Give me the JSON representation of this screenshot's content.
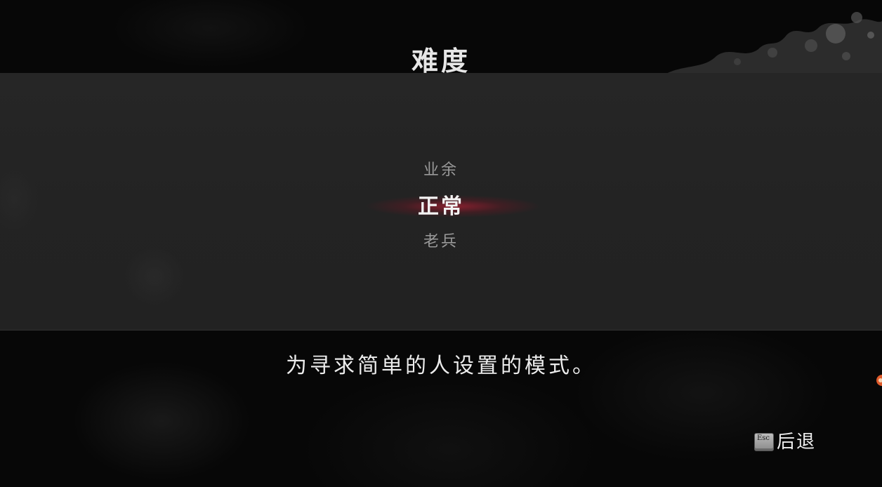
{
  "screen": {
    "title": "难度",
    "difficulty_options": [
      {
        "label": "业余",
        "selected": false
      },
      {
        "label": "正常",
        "selected": true
      },
      {
        "label": "老兵",
        "selected": false
      }
    ],
    "description": "为寻求简单的人设置的模式。",
    "back_button": {
      "key_icon_label": "Esc",
      "label": "后退"
    }
  },
  "colors": {
    "selection_highlight": "#a81e32",
    "panel": "#242424",
    "background": "#070707",
    "text_primary": "#f2f2f2",
    "text_secondary": "#9a9a9a"
  },
  "icons": {
    "back_key": "esc-key-icon",
    "decoration": "ink-splatter"
  }
}
